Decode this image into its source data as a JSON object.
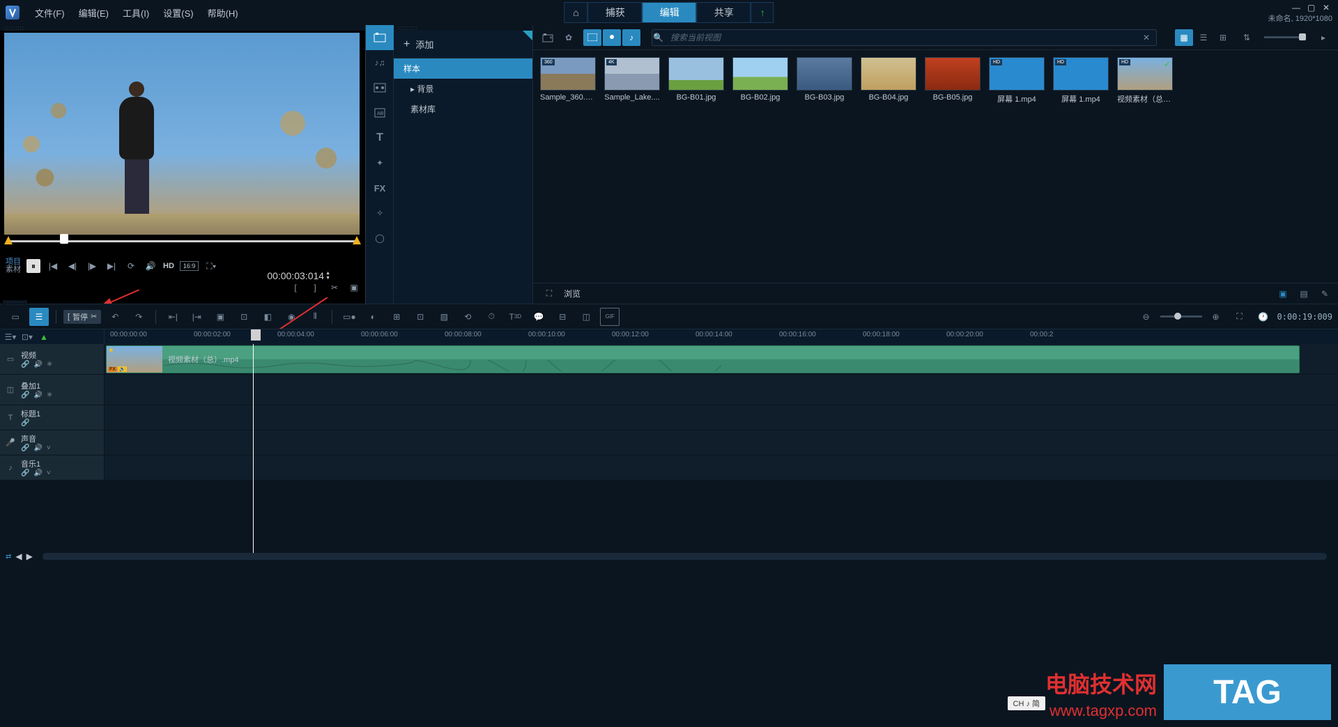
{
  "menubar": {
    "file": "文件(F)",
    "edit": "编辑(E)",
    "tools": "工具(I)",
    "settings": "设置(S)",
    "help": "帮助(H)"
  },
  "tabs": {
    "capture": "捕获",
    "edit": "编辑",
    "share": "共享"
  },
  "project": {
    "name": "未命名",
    "resolution": "1920*1080"
  },
  "preview": {
    "project_label": "项目",
    "source_label": "素材",
    "hd": "HD",
    "ratio": "16:9",
    "timecode": "00:00:03:014"
  },
  "side_labels": {
    "T": "T",
    "FX": "FX"
  },
  "library": {
    "add": "添加",
    "tree": {
      "sample": "样本",
      "background": "背景",
      "materials": "素材库"
    },
    "search_placeholder": "搜索当前视图",
    "browse": "浏览",
    "items": [
      {
        "name": "Sample_360.m..."
      },
      {
        "name": "Sample_Lake...."
      },
      {
        "name": "BG-B01.jpg"
      },
      {
        "name": "BG-B02.jpg"
      },
      {
        "name": "BG-B03.jpg"
      },
      {
        "name": "BG-B04.jpg"
      },
      {
        "name": "BG-B05.jpg"
      },
      {
        "name": "屏幕 1.mp4"
      },
      {
        "name": "屏幕 1.mp4"
      },
      {
        "name": "视频素材（总）...."
      }
    ]
  },
  "timeline": {
    "tooltip": "暂停",
    "time_display": "0:00:19:009",
    "ruler": [
      "00:00:00:00",
      "00:00:02:00",
      "00:00:04:00",
      "00:00:06:00",
      "00:00:08:00",
      "00:00:10:00",
      "00:00:12:00",
      "00:00:14:00",
      "00:00:16:00",
      "00:00:18:00",
      "00:00:20:00",
      "00:00:2"
    ],
    "tracks": {
      "video": "视频",
      "overlay": "叠加1",
      "title": "标题1",
      "voice": "声音",
      "music": "音乐1"
    },
    "clip_name": "视频素材（总）.mp4"
  },
  "ime": "CH ♪ 简",
  "watermark": {
    "line1": "电脑技术网",
    "line2": "www.tagxp.com",
    "tag": "TAG"
  }
}
